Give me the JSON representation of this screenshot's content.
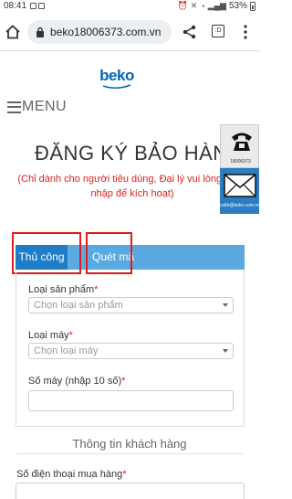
{
  "status_bar": {
    "time": "08:41",
    "battery": "53%"
  },
  "browser": {
    "url": "beko18006373.com.vn",
    "tab_count": ":D"
  },
  "brand": {
    "logo_text": "beko",
    "menu_label": "MENU"
  },
  "page": {
    "title": "ĐĂNG KÝ BẢO HÀNH",
    "subtitle": "(Chỉ dành cho người tiêu dùng, Đại lý vui lòng đăng nhập để kích hoạt)"
  },
  "contact": {
    "phone": "18006373",
    "email": "cskh@beko.com.vn"
  },
  "tabs": [
    {
      "label": "Thủ công",
      "active": true
    },
    {
      "label": "Quét mã",
      "active": false
    }
  ],
  "form": {
    "product_type_label": "Loại sản phẩm",
    "product_type_placeholder": "Chọn loại sản phẩm",
    "machine_type_label": "Loại máy",
    "machine_type_placeholder": "Chọn loại máy",
    "serial_label": "Số máy (nhập 10 số)",
    "required_mark": "*"
  },
  "customer": {
    "section_title": "Thông tin khách hàng",
    "phone_label": "Số điện thoại mua hàng"
  },
  "colors": {
    "brand_blue": "#0066b3",
    "tab_active": "#1f7cc6",
    "tab_bar": "#5aa9e0",
    "required_red": "#e02020",
    "highlight_red": "#e01b1b"
  }
}
